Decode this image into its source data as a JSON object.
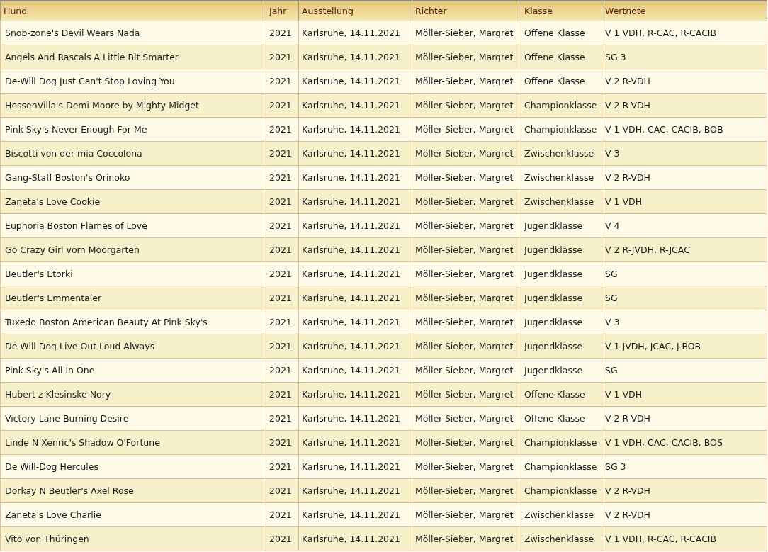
{
  "table": {
    "columns": [
      "Hund",
      "Jahr",
      "Ausstellung",
      "Richter",
      "Klasse",
      "Wertnote"
    ],
    "rows": [
      [
        "Snob-zone's Devil Wears Nada",
        "2021",
        "Karlsruhe, 14.11.2021",
        "Möller-Sieber, Margret",
        "Offene Klasse",
        "V 1 VDH, R-CAC, R-CACIB"
      ],
      [
        "Angels And Rascals A Little Bit Smarter",
        "2021",
        "Karlsruhe, 14.11.2021",
        "Möller-Sieber, Margret",
        "Offene Klasse",
        "SG 3"
      ],
      [
        "De-Will Dog Just Can't Stop Loving You",
        "2021",
        "Karlsruhe, 14.11.2021",
        "Möller-Sieber, Margret",
        "Offene Klasse",
        "V 2 R-VDH"
      ],
      [
        "HessenVilla's Demi Moore by Mighty Midget",
        "2021",
        "Karlsruhe, 14.11.2021",
        "Möller-Sieber, Margret",
        "Championklasse",
        "V 2 R-VDH"
      ],
      [
        "Pink Sky's Never Enough For Me",
        "2021",
        "Karlsruhe, 14.11.2021",
        "Möller-Sieber, Margret",
        "Championklasse",
        "V 1 VDH, CAC, CACIB, BOB"
      ],
      [
        "Biscotti von der mia Coccolona",
        "2021",
        "Karlsruhe, 14.11.2021",
        "Möller-Sieber, Margret",
        "Zwischenklasse",
        "V 3"
      ],
      [
        "Gang-Staff Boston's Orinoko",
        "2021",
        "Karlsruhe, 14.11.2021",
        "Möller-Sieber, Margret",
        "Zwischenklasse",
        "V 2 R-VDH"
      ],
      [
        "Zaneta's Love Cookie",
        "2021",
        "Karlsruhe, 14.11.2021",
        "Möller-Sieber, Margret",
        "Zwischenklasse",
        "V 1 VDH"
      ],
      [
        "Euphoria Boston Flames of Love",
        "2021",
        "Karlsruhe, 14.11.2021",
        "Möller-Sieber, Margret",
        "Jugendklasse",
        "V 4"
      ],
      [
        "Go Crazy Girl vom Moorgarten",
        "2021",
        "Karlsruhe, 14.11.2021",
        "Möller-Sieber, Margret",
        "Jugendklasse",
        "V 2 R-JVDH, R-JCAC"
      ],
      [
        "Beutler's Etorki",
        "2021",
        "Karlsruhe, 14.11.2021",
        "Möller-Sieber, Margret",
        "Jugendklasse",
        "SG"
      ],
      [
        "Beutler's Emmentaler",
        "2021",
        "Karlsruhe, 14.11.2021",
        "Möller-Sieber, Margret",
        "Jugendklasse",
        "SG"
      ],
      [
        "Tuxedo Boston American Beauty At Pink Sky's",
        "2021",
        "Karlsruhe, 14.11.2021",
        "Möller-Sieber, Margret",
        "Jugendklasse",
        "V 3"
      ],
      [
        "De-Will Dog Live Out Loud Always",
        "2021",
        "Karlsruhe, 14.11.2021",
        "Möller-Sieber, Margret",
        "Jugendklasse",
        "V 1 JVDH, JCAC, J-BOB"
      ],
      [
        "Pink Sky's All In One",
        "2021",
        "Karlsruhe, 14.11.2021",
        "Möller-Sieber, Margret",
        "Jugendklasse",
        "SG"
      ],
      [
        "Hubert z Klesinske Nory",
        "2021",
        "Karlsruhe, 14.11.2021",
        "Möller-Sieber, Margret",
        "Offene Klasse",
        "V 1 VDH"
      ],
      [
        "Victory Lane Burning Desire",
        "2021",
        "Karlsruhe, 14.11.2021",
        "Möller-Sieber, Margret",
        "Offene Klasse",
        "V 2 R-VDH"
      ],
      [
        "Linde N Xenric's Shadow O'Fortune",
        "2021",
        "Karlsruhe, 14.11.2021",
        "Möller-Sieber, Margret",
        "Championklasse",
        "V 1 VDH, CAC, CACIB, BOS"
      ],
      [
        "De Will-Dog Hercules",
        "2021",
        "Karlsruhe, 14.11.2021",
        "Möller-Sieber, Margret",
        "Championklasse",
        "SG 3"
      ],
      [
        "Dorkay N Beutler's Axel Rose",
        "2021",
        "Karlsruhe, 14.11.2021",
        "Möller-Sieber, Margret",
        "Championklasse",
        "V 2 R-VDH"
      ],
      [
        "Zaneta's Love Charlie",
        "2021",
        "Karlsruhe, 14.11.2021",
        "Möller-Sieber, Margret",
        "Zwischenklasse",
        "V 2 R-VDH"
      ],
      [
        "Vito von Thüringen",
        "2021",
        "Karlsruhe, 14.11.2021",
        "Möller-Sieber, Margret",
        "Zwischenklasse",
        "V 1 VDH, R-CAC, R-CACIB"
      ]
    ]
  }
}
